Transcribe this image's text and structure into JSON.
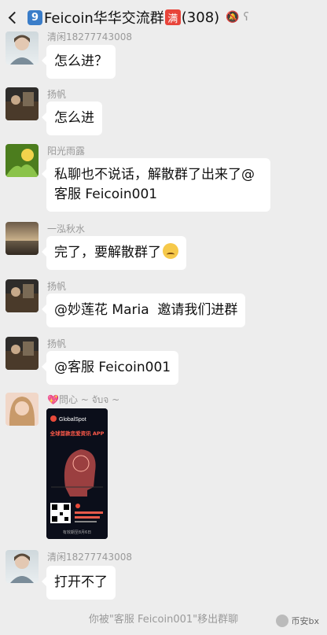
{
  "header": {
    "group_number": "9",
    "title": "Feicoin华华交流群",
    "badge": "满",
    "member_count": "(308)"
  },
  "messages": [
    {
      "sender": "清闲18277743008",
      "text": "怎么进？"
    },
    {
      "sender": "扬帆",
      "text": "怎么进"
    },
    {
      "sender": "阳光雨露",
      "text_line1": "私聊也不说话，解散群了出来了@",
      "text_line2": "客服 Feicoin001"
    },
    {
      "sender": "一泓秋水",
      "text": "完了，要解散群了"
    },
    {
      "sender": "扬帆",
      "text": "@妙莲花 Maria  邀请我们进群"
    },
    {
      "sender": "扬帆",
      "text": "@客服 Feicoin001"
    },
    {
      "sender": "💖問心 ~ จับจ ~",
      "image": {
        "brand": "GlobalSpot",
        "headline": "全球首款恋爱资讯 APP",
        "qr_caption": "有效期至8月6日"
      }
    },
    {
      "sender": "清闲18277743008",
      "text": "打开不了"
    }
  ],
  "system_notice": "你被\"客服 Feicoin001\"移出群聊",
  "watermark": "币安bx",
  "colors": {
    "background": "#ededed",
    "bubble": "#ffffff",
    "badge_red": "#e8443a",
    "badge_blue": "#3a7dc9"
  }
}
